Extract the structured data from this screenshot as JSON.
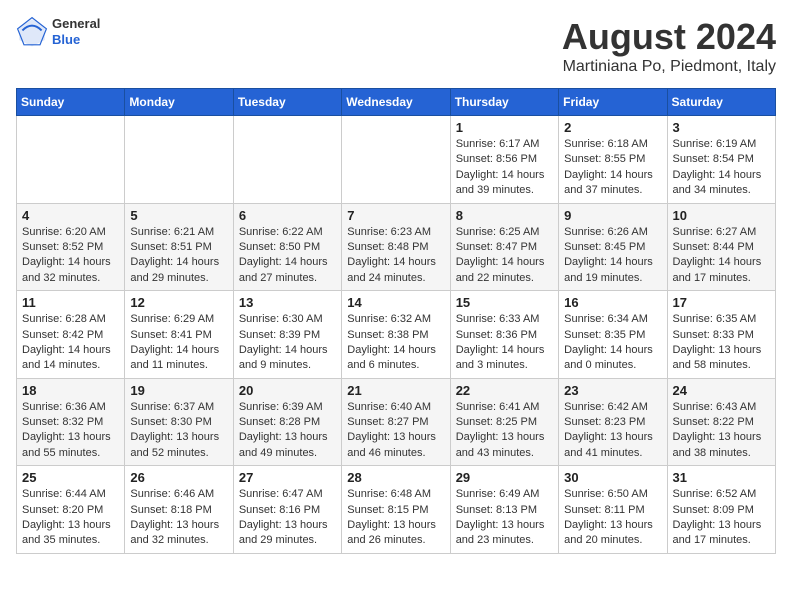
{
  "logo": {
    "general": "General",
    "blue": "Blue"
  },
  "title": "August 2024",
  "subtitle": "Martiniana Po, Piedmont, Italy",
  "days_of_week": [
    "Sunday",
    "Monday",
    "Tuesday",
    "Wednesday",
    "Thursday",
    "Friday",
    "Saturday"
  ],
  "weeks": [
    [
      {
        "day": "",
        "info": ""
      },
      {
        "day": "",
        "info": ""
      },
      {
        "day": "",
        "info": ""
      },
      {
        "day": "",
        "info": ""
      },
      {
        "day": "1",
        "info": "Sunrise: 6:17 AM\nSunset: 8:56 PM\nDaylight: 14 hours and 39 minutes."
      },
      {
        "day": "2",
        "info": "Sunrise: 6:18 AM\nSunset: 8:55 PM\nDaylight: 14 hours and 37 minutes."
      },
      {
        "day": "3",
        "info": "Sunrise: 6:19 AM\nSunset: 8:54 PM\nDaylight: 14 hours and 34 minutes."
      }
    ],
    [
      {
        "day": "4",
        "info": "Sunrise: 6:20 AM\nSunset: 8:52 PM\nDaylight: 14 hours and 32 minutes."
      },
      {
        "day": "5",
        "info": "Sunrise: 6:21 AM\nSunset: 8:51 PM\nDaylight: 14 hours and 29 minutes."
      },
      {
        "day": "6",
        "info": "Sunrise: 6:22 AM\nSunset: 8:50 PM\nDaylight: 14 hours and 27 minutes."
      },
      {
        "day": "7",
        "info": "Sunrise: 6:23 AM\nSunset: 8:48 PM\nDaylight: 14 hours and 24 minutes."
      },
      {
        "day": "8",
        "info": "Sunrise: 6:25 AM\nSunset: 8:47 PM\nDaylight: 14 hours and 22 minutes."
      },
      {
        "day": "9",
        "info": "Sunrise: 6:26 AM\nSunset: 8:45 PM\nDaylight: 14 hours and 19 minutes."
      },
      {
        "day": "10",
        "info": "Sunrise: 6:27 AM\nSunset: 8:44 PM\nDaylight: 14 hours and 17 minutes."
      }
    ],
    [
      {
        "day": "11",
        "info": "Sunrise: 6:28 AM\nSunset: 8:42 PM\nDaylight: 14 hours and 14 minutes."
      },
      {
        "day": "12",
        "info": "Sunrise: 6:29 AM\nSunset: 8:41 PM\nDaylight: 14 hours and 11 minutes."
      },
      {
        "day": "13",
        "info": "Sunrise: 6:30 AM\nSunset: 8:39 PM\nDaylight: 14 hours and 9 minutes."
      },
      {
        "day": "14",
        "info": "Sunrise: 6:32 AM\nSunset: 8:38 PM\nDaylight: 14 hours and 6 minutes."
      },
      {
        "day": "15",
        "info": "Sunrise: 6:33 AM\nSunset: 8:36 PM\nDaylight: 14 hours and 3 minutes."
      },
      {
        "day": "16",
        "info": "Sunrise: 6:34 AM\nSunset: 8:35 PM\nDaylight: 14 hours and 0 minutes."
      },
      {
        "day": "17",
        "info": "Sunrise: 6:35 AM\nSunset: 8:33 PM\nDaylight: 13 hours and 58 minutes."
      }
    ],
    [
      {
        "day": "18",
        "info": "Sunrise: 6:36 AM\nSunset: 8:32 PM\nDaylight: 13 hours and 55 minutes."
      },
      {
        "day": "19",
        "info": "Sunrise: 6:37 AM\nSunset: 8:30 PM\nDaylight: 13 hours and 52 minutes."
      },
      {
        "day": "20",
        "info": "Sunrise: 6:39 AM\nSunset: 8:28 PM\nDaylight: 13 hours and 49 minutes."
      },
      {
        "day": "21",
        "info": "Sunrise: 6:40 AM\nSunset: 8:27 PM\nDaylight: 13 hours and 46 minutes."
      },
      {
        "day": "22",
        "info": "Sunrise: 6:41 AM\nSunset: 8:25 PM\nDaylight: 13 hours and 43 minutes."
      },
      {
        "day": "23",
        "info": "Sunrise: 6:42 AM\nSunset: 8:23 PM\nDaylight: 13 hours and 41 minutes."
      },
      {
        "day": "24",
        "info": "Sunrise: 6:43 AM\nSunset: 8:22 PM\nDaylight: 13 hours and 38 minutes."
      }
    ],
    [
      {
        "day": "25",
        "info": "Sunrise: 6:44 AM\nSunset: 8:20 PM\nDaylight: 13 hours and 35 minutes."
      },
      {
        "day": "26",
        "info": "Sunrise: 6:46 AM\nSunset: 8:18 PM\nDaylight: 13 hours and 32 minutes."
      },
      {
        "day": "27",
        "info": "Sunrise: 6:47 AM\nSunset: 8:16 PM\nDaylight: 13 hours and 29 minutes."
      },
      {
        "day": "28",
        "info": "Sunrise: 6:48 AM\nSunset: 8:15 PM\nDaylight: 13 hours and 26 minutes."
      },
      {
        "day": "29",
        "info": "Sunrise: 6:49 AM\nSunset: 8:13 PM\nDaylight: 13 hours and 23 minutes."
      },
      {
        "day": "30",
        "info": "Sunrise: 6:50 AM\nSunset: 8:11 PM\nDaylight: 13 hours and 20 minutes."
      },
      {
        "day": "31",
        "info": "Sunrise: 6:52 AM\nSunset: 8:09 PM\nDaylight: 13 hours and 17 minutes."
      }
    ]
  ]
}
